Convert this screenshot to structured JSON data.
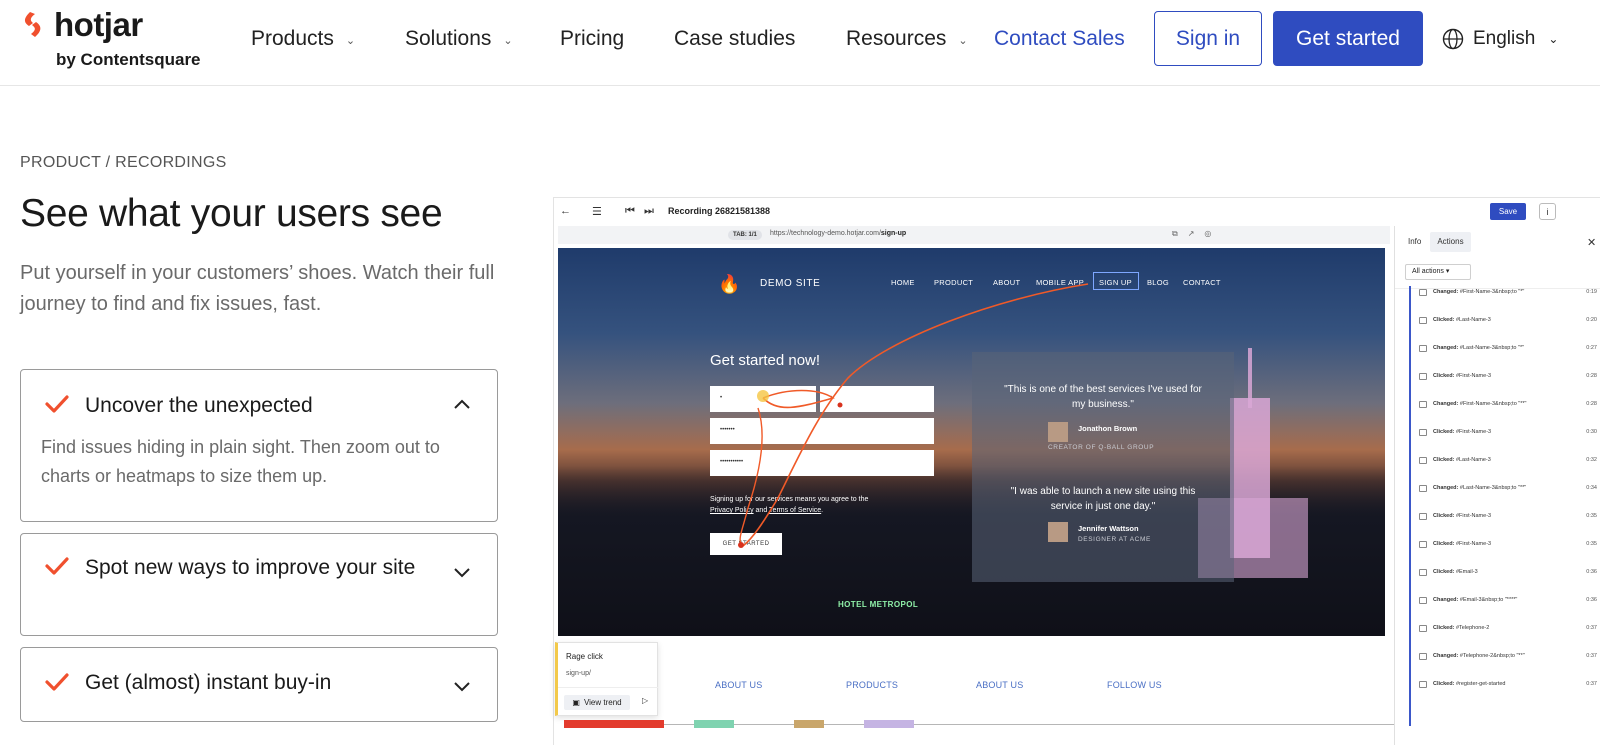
{
  "header": {
    "logo_text": "hotjar",
    "logo_sub": "by Contentsquare",
    "nav": [
      {
        "label": "Products",
        "has_dropdown": true
      },
      {
        "label": "Solutions",
        "has_dropdown": true
      },
      {
        "label": "Pricing",
        "has_dropdown": false
      },
      {
        "label": "Case studies",
        "has_dropdown": false
      },
      {
        "label": "Resources",
        "has_dropdown": true
      }
    ],
    "contact_sales": "Contact Sales",
    "sign_in": "Sign in",
    "get_started": "Get started",
    "language": "English",
    "accent_color": "#2f4cc0",
    "logo_color": "#f0502e"
  },
  "hero": {
    "breadcrumb": "PRODUCT / RECORDINGS",
    "headline": "See what your users see",
    "subtext": "Put yourself in your customers’ shoes. Watch their full journey to find and fix issues, fast."
  },
  "accordion": [
    {
      "title": "Uncover the unexpected",
      "expanded": true,
      "body": "Find issues hiding in plain sight. Then zoom out to charts or heatmaps to size them up."
    },
    {
      "title": "Spot new ways to improve your site",
      "expanded": false
    },
    {
      "title": "Get (almost) instant buy-in",
      "expanded": false
    }
  ],
  "recording": {
    "title": "Recording 26821581388",
    "save": "Save",
    "tab_label": "TAB: 1/1",
    "url_prefix": "https://technology-demo.hotjar.com/",
    "url_path": "sign-up",
    "demo": {
      "site_name": "DEMO SITE",
      "nav": [
        "HOME",
        "PRODUCT",
        "ABOUT",
        "MOBILE APP",
        "SIGN UP",
        "BLOG",
        "CONTACT"
      ],
      "form_title": "Get started now!",
      "terms_line1": "Signing up for our services means you agree to the",
      "terms_privacy": "Privacy Policy",
      "terms_and": "and",
      "terms_tos": "Terms of Service",
      "button": "GET STARTED",
      "quote1": "\"This is one of the best services I've used for my business.\"",
      "name1": "Jonathon Brown",
      "role1": "CREATOR OF Q-BALL GROUP",
      "quote2": "\"I was able to launch a new site using this service in just one day.\"",
      "name2": "Jennifer Wattson",
      "role2": "DESIGNER AT ACME",
      "hotel": "HOTEL METROPOL",
      "footer_links": [
        "ABOUT US",
        "PRODUCTS",
        "ABOUT US",
        "FOLLOW US"
      ]
    },
    "popup": {
      "title": "Rage click",
      "url": "sign-up/",
      "view_trend": "View trend"
    },
    "panel": {
      "tabs": [
        "Info",
        "Actions"
      ],
      "filter": "All actions",
      "actions": [
        {
          "verb": "Changed:",
          "target": "#First-Name-3&nbsp;to \"*\"",
          "time": "0:19"
        },
        {
          "verb": "Clicked:",
          "target": "#Last-Name-3",
          "time": "0:20"
        },
        {
          "verb": "Changed:",
          "target": "#Last-Name-3&nbsp;to \"*\"",
          "time": "0:27"
        },
        {
          "verb": "Clicked:",
          "target": "#First-Name-3",
          "time": "0:28"
        },
        {
          "verb": "Changed:",
          "target": "#First-Name-3&nbsp;to \"**\"",
          "time": "0:28"
        },
        {
          "verb": "Clicked:",
          "target": "#First-Name-3",
          "time": "0:30"
        },
        {
          "verb": "Clicked:",
          "target": "#Last-Name-3",
          "time": "0:32"
        },
        {
          "verb": "Changed:",
          "target": "#Last-Name-3&nbsp;to \"**\"",
          "time": "0:34"
        },
        {
          "verb": "Clicked:",
          "target": "#First-Name-3",
          "time": "0:35"
        },
        {
          "verb": "Clicked:",
          "target": "#First-Name-3",
          "time": "0:35"
        },
        {
          "verb": "Clicked:",
          "target": "#Email-3",
          "time": "0:36"
        },
        {
          "verb": "Changed:",
          "target": "#Email-3&nbsp;to \"****\"",
          "time": "0:36"
        },
        {
          "verb": "Clicked:",
          "target": "#Telephone-2",
          "time": "0:37"
        },
        {
          "verb": "Changed:",
          "target": "#Telephone-2&nbsp;to \"**\"",
          "time": "0:37"
        },
        {
          "verb": "Clicked:",
          "target": "#register-get-started",
          "time": "0:37"
        }
      ]
    }
  }
}
